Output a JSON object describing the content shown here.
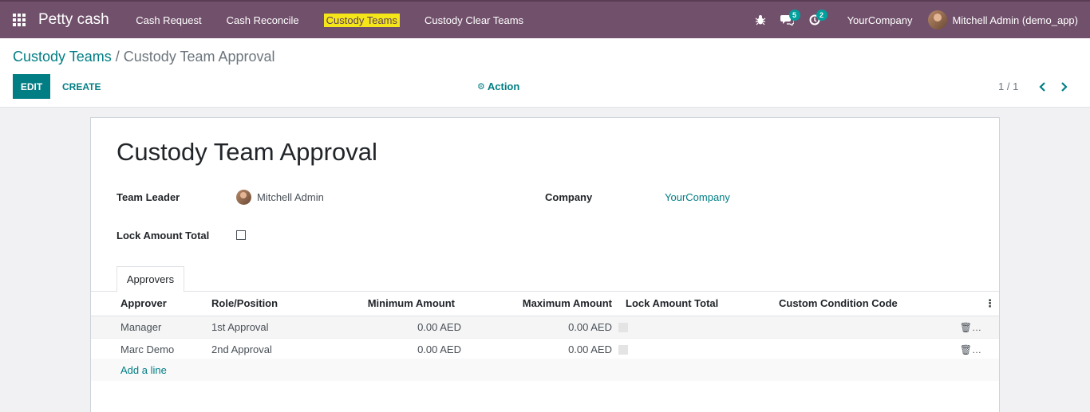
{
  "navbar": {
    "app_title": "Petty cash",
    "menu": [
      "Cash Request",
      "Cash Reconcile",
      "Custody Teams",
      "Custody Clear Teams"
    ],
    "active_menu": "Custody Teams",
    "messages_count": "5",
    "activities_count": "2",
    "company": "YourCompany",
    "user": "Mitchell Admin (demo_app)"
  },
  "control_panel": {
    "breadcrumb_parent": "Custody Teams",
    "breadcrumb_sep": "/",
    "breadcrumb_current": "Custody Team Approval",
    "edit_label": "EDIT",
    "create_label": "CREATE",
    "action_label": "Action",
    "pager": "1 / 1"
  },
  "form": {
    "title": "Custody Team Approval",
    "team_leader_label": "Team Leader",
    "team_leader": "Mitchell Admin",
    "company_label": "Company",
    "company": "YourCompany",
    "lock_amount_label": "Lock Amount Total",
    "lock_amount_checked": false,
    "tab_label": "Approvers",
    "columns": [
      "Approver",
      "Role/Position",
      "Minimum Amount",
      "Maximum Amount",
      "Lock Amount Total",
      "Custom Condition Code"
    ],
    "rows": [
      {
        "approver": "Manager",
        "role": "1st Approval",
        "min": "0.00 AED",
        "max": "0.00 AED"
      },
      {
        "approver": "Marc Demo",
        "role": "2nd Approval",
        "min": "0.00 AED",
        "max": "0.00 AED"
      }
    ],
    "add_line": "Add a line"
  },
  "colors": {
    "navbar": "#71506b",
    "accent": "#017e84",
    "highlight": "#f5e61a"
  }
}
